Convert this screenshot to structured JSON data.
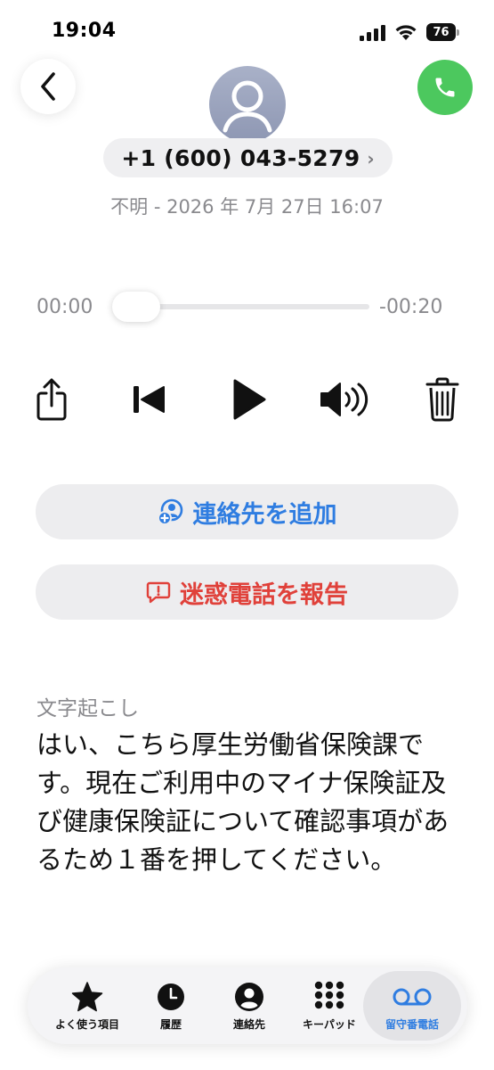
{
  "status_bar": {
    "time": "19:04",
    "battery": "76"
  },
  "header": {
    "phone_number": "+1 (600) 043-5279",
    "chevron": "›",
    "subinfo": "不明 - 2026 年 7月 27日 16:07"
  },
  "player": {
    "elapsed": "00:00",
    "remaining": "-00:20",
    "progress": 0
  },
  "actions": {
    "add_contact": "連絡先を追加",
    "report_spam": "迷惑電話を報告"
  },
  "transcript": {
    "title": "文字起こし",
    "body": "はい、こちら厚生労働省保険課です。現在ご利用中のマイナ保険証及び健康保険証について確認事項があるため１番を押してください。"
  },
  "tabs": [
    {
      "label": "よく使う項目",
      "icon": "star-icon"
    },
    {
      "label": "履歴",
      "icon": "clock-icon"
    },
    {
      "label": "連絡先",
      "icon": "person-circle-icon"
    },
    {
      "label": "キーパッド",
      "icon": "keypad-icon"
    },
    {
      "label": "留守番電話",
      "icon": "voicemail-icon",
      "active": true
    }
  ],
  "colors": {
    "accent_blue": "#2f7de1",
    "danger_red": "#e0413a",
    "call_green": "#4cc85e"
  }
}
